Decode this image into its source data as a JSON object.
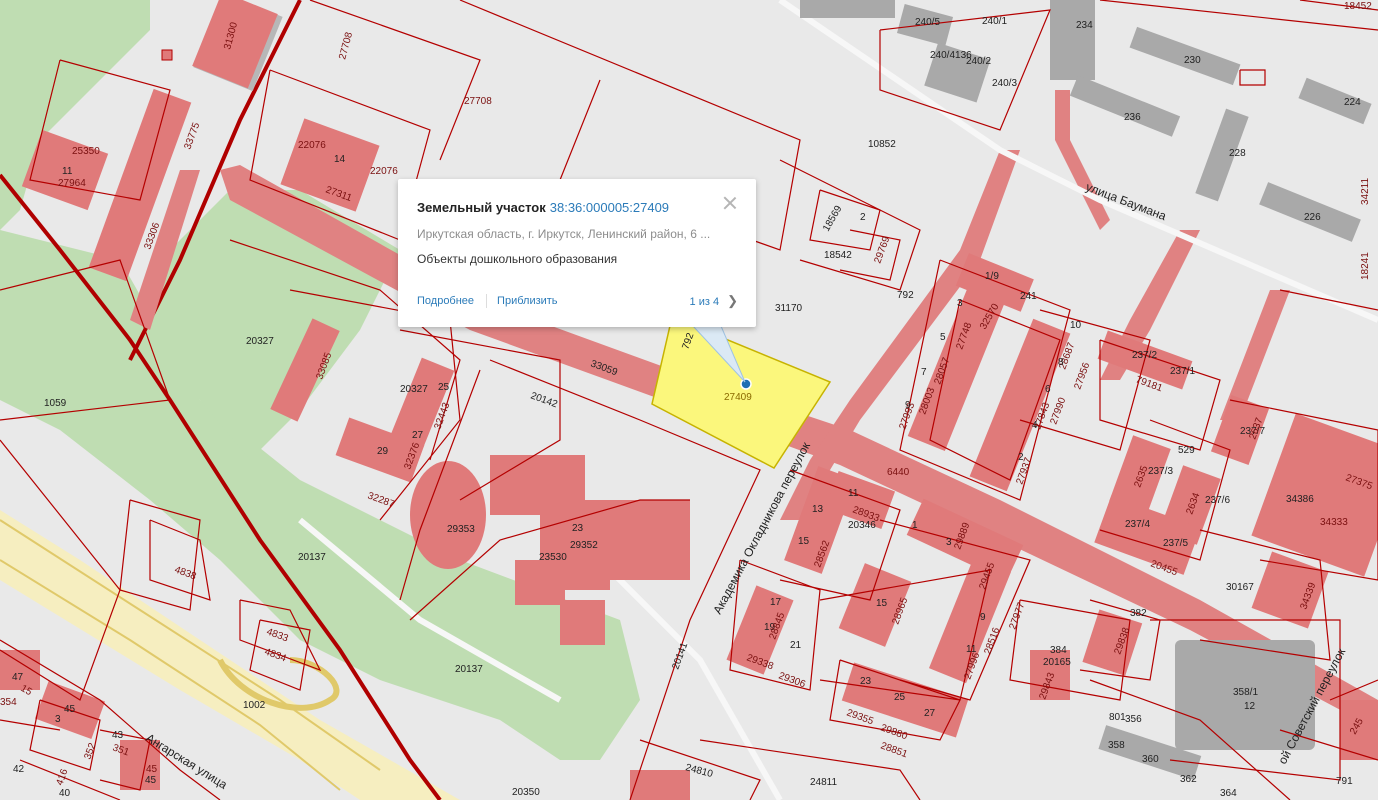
{
  "popup": {
    "title": "Земельный участок",
    "cadastral_number": "38:36:000005:27409",
    "address": "Иркутская область, г. Иркутск, Ленинский район, 6 ...",
    "purpose": "Объекты дошкольного образования",
    "details_label": "Подробнее",
    "zoom_label": "Приблизить",
    "pager": "1 из 4",
    "next_glyph": "❯"
  },
  "selected_parcel": {
    "label": "27409",
    "fill": "#fbf77c",
    "border": "#c7b300"
  },
  "colors": {
    "parcel_border": "#b40000",
    "building": "#e07a7a",
    "green": "#bfddb2",
    "link": "#2b7bb9"
  },
  "streets": {
    "baumana": "улица Баумана",
    "okladnikova": "Академика Окладникова переулок",
    "angarskaya": "Ангарская улица",
    "sovetsky": "ой Советский переулок"
  },
  "labels": {
    "l31300": "31300",
    "l27708a": "27708",
    "l27708b": "27708",
    "l25350": "25350",
    "l11a": "11",
    "l27964": "27964",
    "l33775": "33775",
    "l33306": "33306",
    "l22076a": "22076",
    "l14": "14",
    "l27311": "27311",
    "l22076b": "22076",
    "l1059": "1059",
    "l20327a": "20327",
    "l33085": "33085",
    "l20327b": "20327",
    "l25a": "25",
    "l32443": "32443",
    "l27a": "27",
    "l29a": "29",
    "l32376": "32376",
    "l32287": "32287",
    "l20142": "20142",
    "l33059": "33059",
    "l792a": "792",
    "l31170": "31170",
    "l18569": "18569",
    "l2a": "2",
    "l29769": "29769",
    "l18542": "18542",
    "l10852": "10852",
    "l792b": "792",
    "l240_5": "240/5",
    "l240_1": "240/1",
    "l240_4136": "240/4136",
    "l240_2": "240/2",
    "l240_3": "240/3",
    "l234": "234",
    "l230": "230",
    "l236": "236",
    "l228": "228",
    "l224": "224",
    "l226": "226",
    "l34211": "34211",
    "l18452": "18452",
    "l18241": "18241",
    "l29353": "29353",
    "l23a": "23",
    "l29352": "29352",
    "l23530": "23530",
    "l20137a": "20137",
    "l20137b": "20137",
    "l4838": "4838",
    "l4833": "4833",
    "l4834": "4834",
    "l1002": "1002",
    "l20141": "20141",
    "l20350": "20350",
    "l24810": "24810",
    "l24811": "24811",
    "l6440": "6440",
    "l11b": "11",
    "l28933": "28933",
    "l20346": "20346",
    "l13": "13",
    "l15": "15",
    "l28562": "28562",
    "l1_9": "1/9",
    "l241": "241",
    "l3a": "3",
    "l32570": "32570",
    "l5a": "5",
    "l27748": "27748",
    "l28057": "28057",
    "l7a": "7",
    "l28003": "28003",
    "l9a": "9",
    "l27993": "27993",
    "l10": "10",
    "l28687": "28687",
    "l27956": "27956",
    "l8": "8",
    "l6": "6",
    "l27843": "27843",
    "l27990": "27990",
    "l4": "4",
    "l2b": "2",
    "l27937": "27937",
    "l237_2": "237/2",
    "l79181": "79181",
    "l237_1": "237/1",
    "l237_7": "237/7",
    "l2637": "2637",
    "l529": "529",
    "l237_3": "237/3",
    "l2635": "2635",
    "l237_6": "237/6",
    "l2634": "2634",
    "l237_4": "237/4",
    "l237_5": "237/5",
    "l20455": "20455",
    "l34386": "34386",
    "l27375": "27375",
    "l34333": "34333",
    "l30167": "30167",
    "l34339": "34339",
    "l1": "1",
    "l3b": "3",
    "l29889": "29889",
    "l29455": "29455",
    "l27977": "27977",
    "l28516": "28516",
    "l27996": "27996",
    "l9b": "9",
    "l11c": "11",
    "l15b": "15",
    "l28965": "28965",
    "l17": "17",
    "l19": "19",
    "l28845": "28845",
    "l21": "21",
    "l29338": "29338",
    "l29306": "29306",
    "l23b": "23",
    "l25b": "25",
    "l27b": "27",
    "l29355": "29355",
    "l29880": "29880",
    "l28851": "28851",
    "l382": "382",
    "l384": "384",
    "l20165": "20165",
    "l29838": "29838",
    "l29843": "29843",
    "l358_1": "358/1",
    "l12": "12",
    "l801": "801",
    "l356": "356",
    "l358": "358",
    "l360": "360",
    "l362": "362",
    "l364": "364",
    "l791": "791",
    "l245": "245",
    "l47": "47",
    "l15c": "15",
    "l354": "354",
    "l45a": "45",
    "l3c": "3",
    "l43": "43",
    "l351": "351",
    "l352": "352",
    "l42": "42",
    "l45b": "45",
    "l40": "40",
    "l416": "416"
  }
}
